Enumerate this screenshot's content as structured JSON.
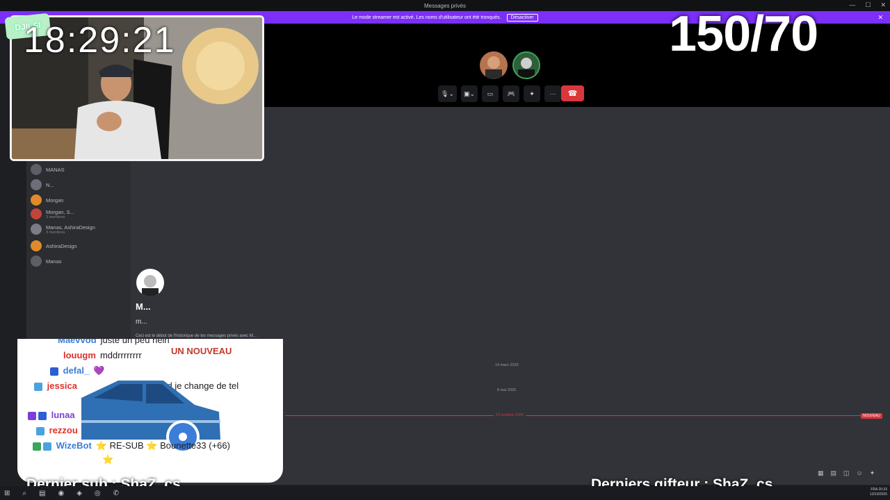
{
  "window": {
    "title": "Messages privés"
  },
  "banner": {
    "text": "Le mode streamer est activé. Les noms d'utilisateur ont été tronqués.",
    "button": "Désactiver"
  },
  "call_controls": {
    "more": "···"
  },
  "dm_list": [
    {
      "name": "MANAS",
      "sub": ""
    },
    {
      "name": "N...",
      "sub": ""
    },
    {
      "name": "Morgan",
      "sub": ""
    },
    {
      "name": "Morgan, S...",
      "sub": "3 membres"
    },
    {
      "name": "Manas, AshiraDesign",
      "sub": "3 membres"
    },
    {
      "name": "AshiraDesign",
      "sub": ""
    },
    {
      "name": "Manas",
      "sub": ""
    }
  ],
  "profile": {
    "name": "M...",
    "username": "m...",
    "intro": "Ceci est le début de l'historique de tes messages privés avec M..."
  },
  "dates": {
    "d1": "14 mars 2025",
    "d2": "8 mai 2025",
    "d3": "13 octobre 2025",
    "new_label": "NOUVEAU"
  },
  "overlay": {
    "clock": "18:29:21",
    "badge": "DJILSI",
    "goal": "150/70",
    "last_sub": "Dernier sub : ShaZ_cs",
    "last_gifter": "Derniers gifteur : ShaZ_cs",
    "new_banner": "UN NOUVEAU"
  },
  "chat_messages": [
    {
      "user": "Maevvod",
      "text": "juste un peu hein",
      "color": "#3b7dd8"
    },
    {
      "user": "louugm",
      "text": "mddrrrrrrrr",
      "color": "#e0302a"
    },
    {
      "user": "defal_",
      "text": "💜",
      "color": "#3b7dd8"
    },
    {
      "user": "jessica",
      "text": "moi quand je change de tel",
      "color": "#e0302a"
    },
    {
      "user": "lunaa",
      "text": "",
      "color": "#7b3fd8"
    },
    {
      "user": "rezzou",
      "text": "",
      "color": "#e0302a"
    },
    {
      "user": "WizeBot",
      "text": "RE-SUB ⭐ Bounette33 (+66)",
      "color": "#3b7dd8"
    }
  ],
  "taskbar": {
    "lang": "FRA",
    "time": "20:33",
    "date": "13/10/2025"
  }
}
